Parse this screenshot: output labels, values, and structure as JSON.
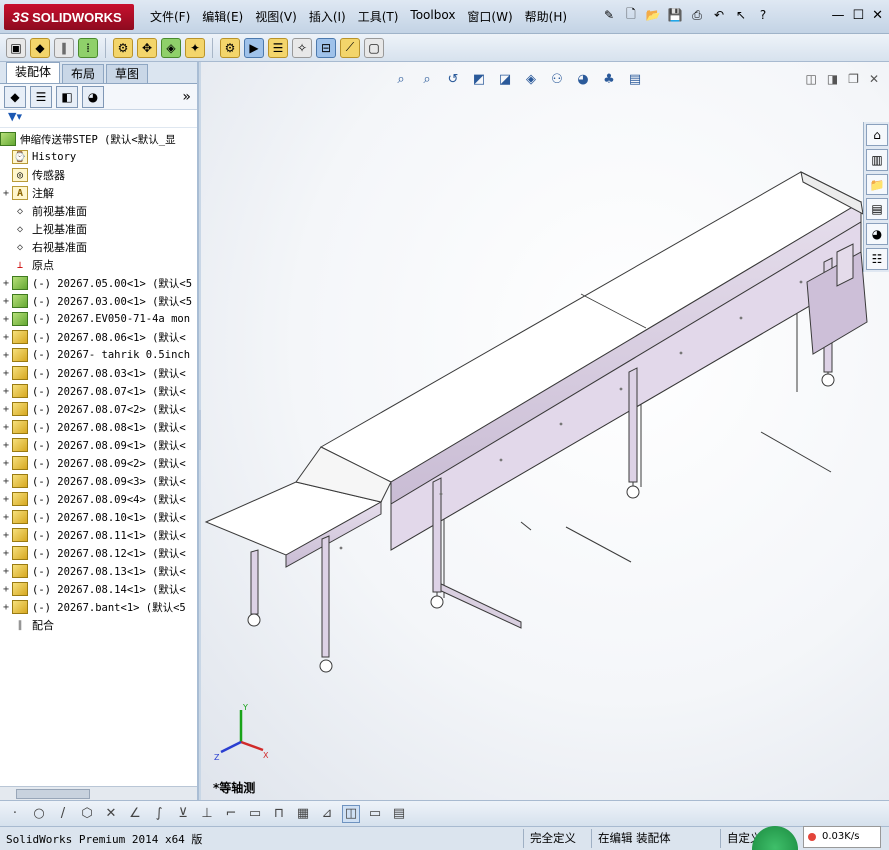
{
  "app": {
    "logo_ds": "3S",
    "logo_text": "SOLIDWORKS"
  },
  "menu": [
    "文件(F)",
    "编辑(E)",
    "视图(V)",
    "插入(I)",
    "工具(T)",
    "Toolbox",
    "窗口(W)",
    "帮助(H)"
  ],
  "tabs": [
    "装配体",
    "布局",
    "草图"
  ],
  "tree": {
    "root": "伸缩传送带STEP (默认<默认_显",
    "items": [
      {
        "kind": "hist",
        "label": "History"
      },
      {
        "kind": "sensor",
        "label": "传感器"
      },
      {
        "kind": "note",
        "label": "注解",
        "exp": true
      },
      {
        "kind": "plane",
        "label": "前视基准面"
      },
      {
        "kind": "plane",
        "label": "上视基准面"
      },
      {
        "kind": "plane",
        "label": "右视基准面"
      },
      {
        "kind": "origin",
        "label": "原点"
      },
      {
        "kind": "asmg",
        "label": "(-) 20267.05.00<1> (默认<5",
        "exp": true
      },
      {
        "kind": "asmg",
        "label": "(-) 20267.03.00<1> (默认<5",
        "exp": true
      },
      {
        "kind": "asmg",
        "label": "(-) 20267.EV050-71-4a mon",
        "exp": true
      },
      {
        "kind": "asm",
        "label": "(-) 20267.08.06<1> (默认<",
        "exp": true
      },
      {
        "kind": "asm",
        "label": "(-) 20267- tahrik 0.5inch",
        "exp": true
      },
      {
        "kind": "asm",
        "label": "(-) 20267.08.03<1> (默认<",
        "exp": true
      },
      {
        "kind": "asm",
        "label": "(-) 20267.08.07<1> (默认<",
        "exp": true
      },
      {
        "kind": "asm",
        "label": "(-) 20267.08.07<2> (默认<",
        "exp": true
      },
      {
        "kind": "asm",
        "label": "(-) 20267.08.08<1> (默认<",
        "exp": true
      },
      {
        "kind": "asm",
        "label": "(-) 20267.08.09<1> (默认<",
        "exp": true
      },
      {
        "kind": "asm",
        "label": "(-) 20267.08.09<2> (默认<",
        "exp": true
      },
      {
        "kind": "asm",
        "label": "(-) 20267.08.09<3> (默认<",
        "exp": true
      },
      {
        "kind": "asm",
        "label": "(-) 20267.08.09<4> (默认<",
        "exp": true
      },
      {
        "kind": "asm",
        "label": "(-) 20267.08.10<1> (默认<",
        "exp": true
      },
      {
        "kind": "asm",
        "label": "(-) 20267.08.11<1> (默认<",
        "exp": true
      },
      {
        "kind": "asm",
        "label": "(-) 20267.08.12<1> (默认<",
        "exp": true
      },
      {
        "kind": "asm",
        "label": "(-) 20267.08.13<1> (默认<",
        "exp": true
      },
      {
        "kind": "asm",
        "label": "(-) 20267.08.14<1> (默认<",
        "exp": true
      },
      {
        "kind": "asm",
        "label": "(-) 20267.bant<1> (默认<5",
        "exp": true
      },
      {
        "kind": "mate",
        "label": "配合"
      }
    ]
  },
  "viewport": {
    "view_name": "*等轴测",
    "triad": {
      "x": "X",
      "y": "Y",
      "z": "Z"
    }
  },
  "status": {
    "app_version": "SolidWorks Premium 2014 x64 版",
    "state": "完全定义",
    "editing": "在编辑 装配体",
    "custom": "自定义",
    "net_speed": "0.03K/s"
  },
  "colors": {
    "frame": "#d9cfe0",
    "frame_stroke": "#3a3a3a",
    "belt": "#ffffff"
  }
}
